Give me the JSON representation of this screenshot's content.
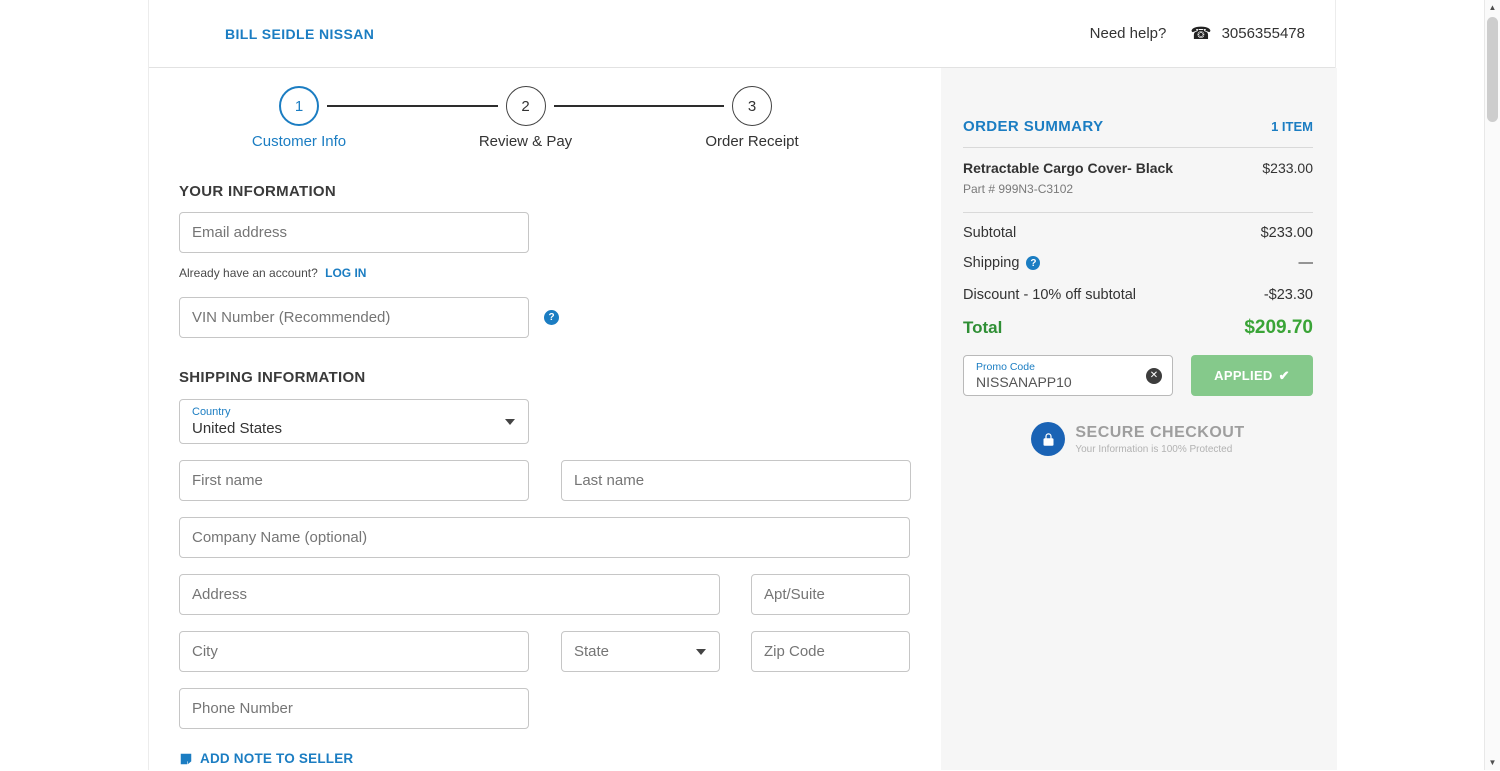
{
  "header": {
    "dealer_name": "BILL SEIDLE NISSAN",
    "help_text": "Need help?",
    "phone": "3056355478"
  },
  "stepper": {
    "steps": [
      {
        "number": "1",
        "label": "Customer Info"
      },
      {
        "number": "2",
        "label": "Review & Pay"
      },
      {
        "number": "3",
        "label": "Order Receipt"
      }
    ]
  },
  "your_information": {
    "title": "YOUR INFORMATION",
    "email_placeholder": "Email address",
    "account_text": "Already have an account?",
    "login_link": "LOG IN",
    "vin_placeholder": "VIN Number (Recommended)",
    "vin_help_icon": "?"
  },
  "shipping_form": {
    "title": "SHIPPING INFORMATION",
    "country_label": "Country",
    "country_value": "United States",
    "first_name_placeholder": "First name",
    "last_name_placeholder": "Last name",
    "company_placeholder": "Company Name (optional)",
    "address_placeholder": "Address",
    "apt_placeholder": "Apt/Suite",
    "city_placeholder": "City",
    "state_placeholder": "State",
    "zip_placeholder": "Zip Code",
    "phone_placeholder": "Phone Number",
    "add_note_link": "ADD NOTE TO SELLER"
  },
  "order_summary": {
    "title": "ORDER SUMMARY",
    "item_count": "1 ITEM",
    "product": {
      "name": "Retractable Cargo Cover- Black",
      "part": "Part # 999N3-C3102",
      "price": "$233.00"
    },
    "subtotal_label": "Subtotal",
    "subtotal_value": "$233.00",
    "shipping_label": "Shipping",
    "shipping_help_icon": "?",
    "shipping_value": "—",
    "discount_label": "Discount - 10% off subtotal",
    "discount_value": "-$23.30",
    "total_label": "Total",
    "total_value": "$209.70",
    "promo": {
      "label": "Promo Code",
      "value": "NISSANAPP10",
      "applied_label": "APPLIED",
      "applied_check": "✔",
      "clear_icon": "✕"
    },
    "secure": {
      "title": "SECURE CHECKOUT",
      "subtitle": "Your Information is 100% Protected"
    }
  },
  "colors": {
    "accent_blue": "#1b7dc2",
    "total_green": "#3aa437",
    "applied_button_green": "#85c98b",
    "sidebar_bg": "#f6f6f6"
  }
}
